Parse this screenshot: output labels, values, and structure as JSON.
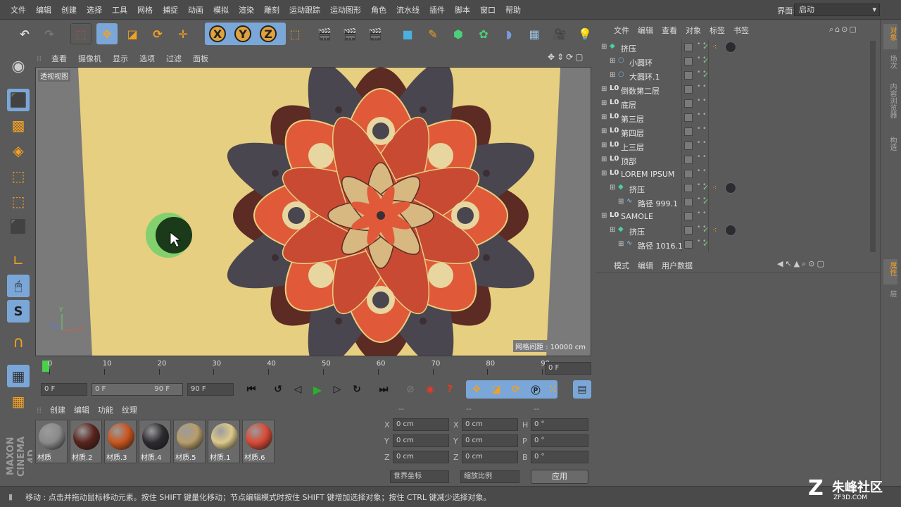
{
  "menu": [
    "文件",
    "编辑",
    "创建",
    "选择",
    "工具",
    "网格",
    "捕捉",
    "动画",
    "模拟",
    "渲染",
    "雕刻",
    "运动跟踪",
    "运动图形",
    "角色",
    "流水线",
    "插件",
    "脚本",
    "窗口",
    "帮助"
  ],
  "layout": {
    "label": "界面:",
    "value": "启动"
  },
  "viewport": {
    "menu": [
      "查看",
      "摄像机",
      "显示",
      "选项",
      "过滤",
      "面板"
    ],
    "label": "透视视图",
    "grid_info": "网格间距 : 10000 cm",
    "axis_y": "Y",
    "axis_z": "Z",
    "axis_x": "X"
  },
  "timeline": {
    "ticks": [
      "0",
      "10",
      "20",
      "30",
      "40",
      "50",
      "60",
      "70",
      "80",
      "90"
    ],
    "current": "0 F"
  },
  "transport": {
    "start": "0 F",
    "range_start": "0 F",
    "range_end": "90 F",
    "end": "90 F"
  },
  "materials": {
    "menu": [
      "创建",
      "编辑",
      "功能",
      "纹理"
    ],
    "items": [
      {
        "name": "材质",
        "color": "#8a8a8a"
      },
      {
        "name": "材质.2",
        "color": "#5a231c"
      },
      {
        "name": "材质.3",
        "color": "#c9551e"
      },
      {
        "name": "材质.4",
        "color": "#2e2b30"
      },
      {
        "name": "材质.5",
        "color": "#b79d6a"
      },
      {
        "name": "材质.1",
        "color": "#dcc98a"
      },
      {
        "name": "材质.6",
        "color": "#d84a36"
      }
    ]
  },
  "coords": {
    "headers": [
      "--",
      "--",
      "--"
    ],
    "rows": [
      {
        "a": "X",
        "av": "0 cm",
        "b": "X",
        "bv": "0 cm",
        "c": "H",
        "cv": "0 °"
      },
      {
        "a": "Y",
        "av": "0 cm",
        "b": "Y",
        "bv": "0 cm",
        "c": "P",
        "cv": "0 °"
      },
      {
        "a": "Z",
        "av": "0 cm",
        "b": "Z",
        "bv": "0 cm",
        "c": "B",
        "cv": "0 °"
      }
    ],
    "space": "世界坐标",
    "scale": "缩放比例",
    "apply": "应用"
  },
  "objects": {
    "menu": [
      "文件",
      "编辑",
      "查看",
      "对象",
      "标签",
      "书签"
    ],
    "rows": [
      {
        "name": "挤压",
        "indent": 0,
        "icon": "extrude-icon",
        "check": true,
        "tags": true
      },
      {
        "name": "小圆环",
        "indent": 1,
        "icon": "circle-icon",
        "check": true,
        "tags": false
      },
      {
        "name": "大圆环.1",
        "indent": 1,
        "icon": "circle-icon",
        "check": true,
        "tags": false
      },
      {
        "name": "倒数第二层",
        "indent": 0,
        "icon": "null-icon",
        "check": false,
        "tags": false
      },
      {
        "name": "底层",
        "indent": 0,
        "icon": "null-icon",
        "check": false,
        "tags": false
      },
      {
        "name": "第三层",
        "indent": 0,
        "icon": "null-icon",
        "check": false,
        "tags": false
      },
      {
        "name": "第四层",
        "indent": 0,
        "icon": "null-icon",
        "check": false,
        "tags": false
      },
      {
        "name": "上三层",
        "indent": 0,
        "icon": "null-icon",
        "check": false,
        "tags": false
      },
      {
        "name": "顶部",
        "indent": 0,
        "icon": "null-icon",
        "check": false,
        "tags": false
      },
      {
        "name": "LOREM IPSUM",
        "indent": 0,
        "icon": "null-icon",
        "check": false,
        "tags": false
      },
      {
        "name": "挤压",
        "indent": 1,
        "icon": "extrude-icon",
        "check": true,
        "tags": true
      },
      {
        "name": "路径 999.1",
        "indent": 2,
        "icon": "spline-icon",
        "check": true,
        "tags": false
      },
      {
        "name": "SAMOLE",
        "indent": 0,
        "icon": "null-icon",
        "check": false,
        "tags": false
      },
      {
        "name": "挤压",
        "indent": 1,
        "icon": "extrude-icon",
        "check": true,
        "tags": true
      },
      {
        "name": "路径 1016.1",
        "indent": 2,
        "icon": "spline-icon",
        "check": true,
        "tags": false
      }
    ]
  },
  "attributes": {
    "menu": [
      "模式",
      "编辑",
      "用户数据"
    ]
  },
  "right_tabs": [
    "对象",
    "场次",
    "内容浏览器",
    "构造"
  ],
  "right_tabs2": [
    "属性",
    "层"
  ],
  "status": "移动 : 点击并拖动鼠标移动元素。按住 SHIFT 键量化移动；节点编辑模式时按住 SHIFT 键增加选择对象；按住 CTRL 键减少选择对象。",
  "watermark": {
    "brand": "朱峰社区",
    "url": "ZF3D.COM"
  },
  "logo": "MAXON CINEMA 4D"
}
